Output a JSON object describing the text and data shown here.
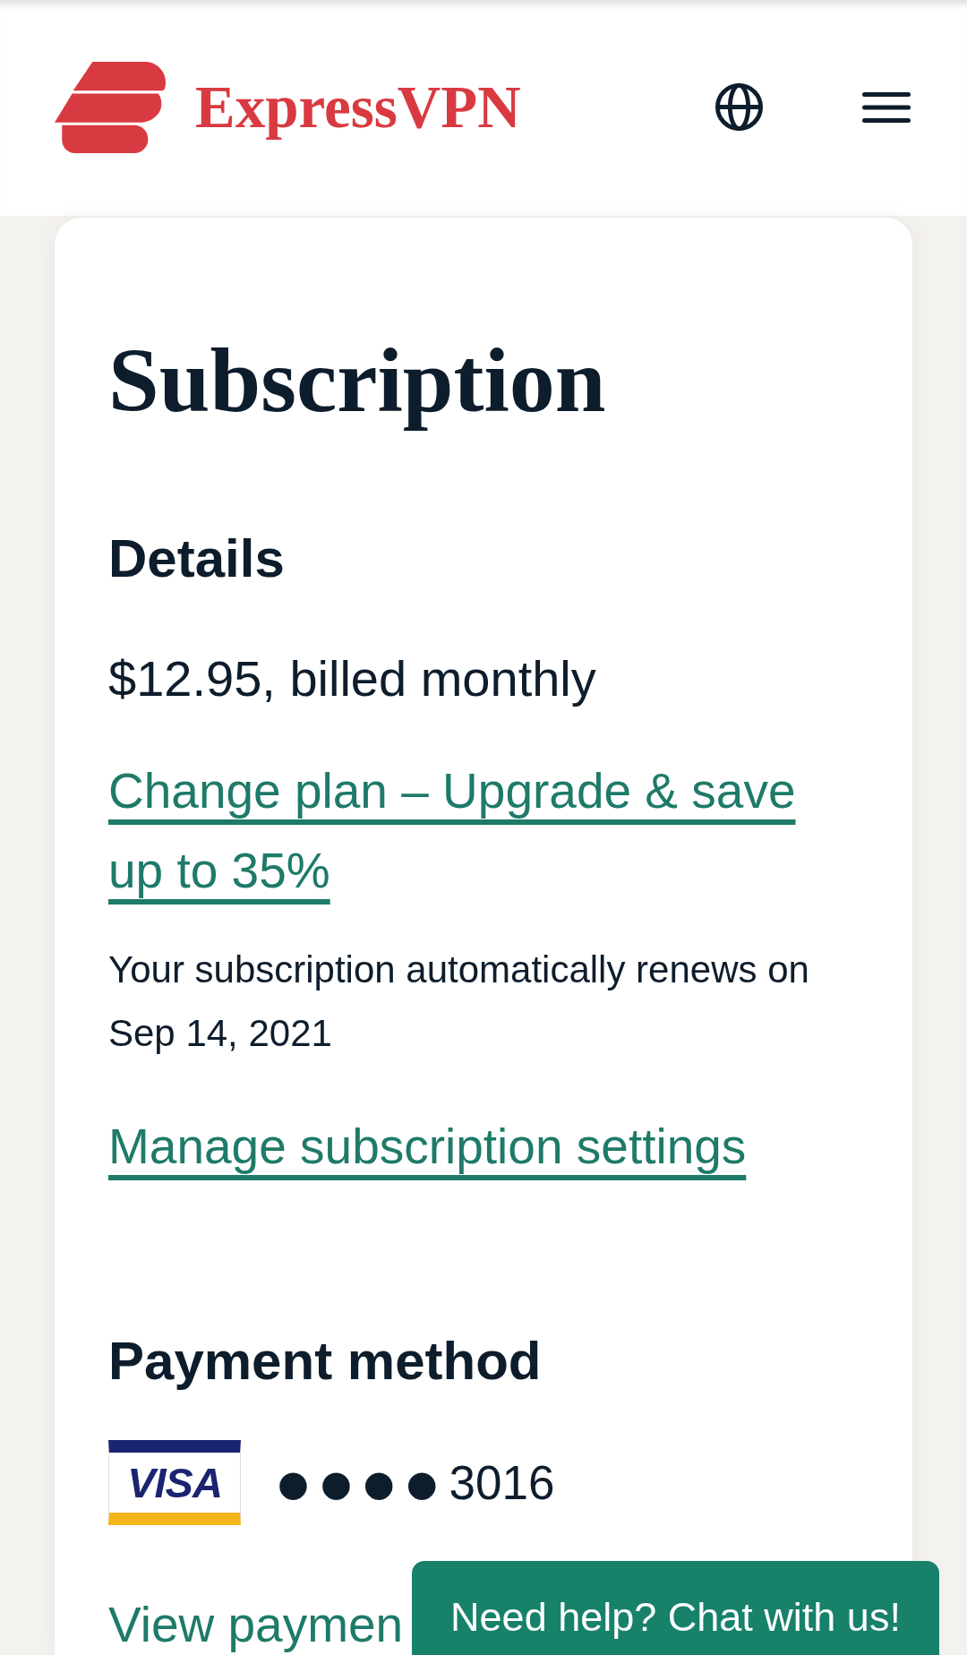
{
  "header": {
    "brand": "ExpressVPN"
  },
  "page": {
    "title": "Subscription"
  },
  "details": {
    "heading": "Details",
    "price": "$12.95, billed monthly",
    "change_plan_link": "Change plan – Upgrade & save up to 35%",
    "renewal_note": "Your subscription automatically renews on Sep 14, 2021",
    "manage_link": "Manage subscription settings"
  },
  "payment_method": {
    "heading": "Payment method",
    "card": {
      "brand": "VISA",
      "mask": "●●●●",
      "last_digits": "3016"
    },
    "view_link": "View paymen"
  },
  "chat_button": {
    "label": "Need help? Chat with us!"
  }
}
